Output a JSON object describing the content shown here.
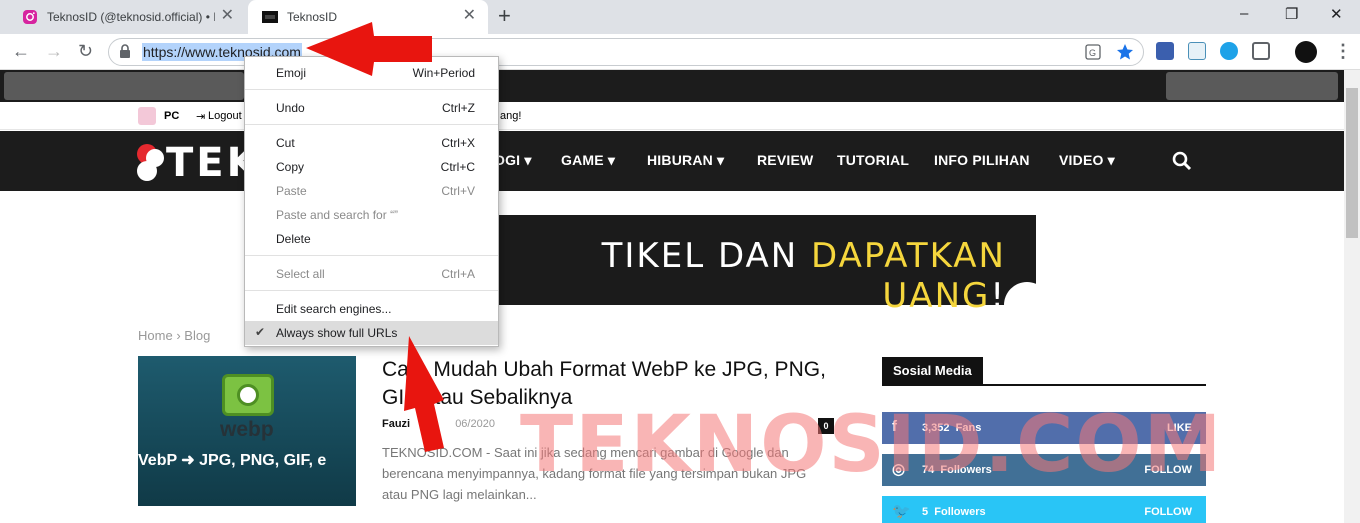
{
  "browser": {
    "tabs": [
      {
        "title": "TeknosID (@teknosid.official) • In",
        "active": false
      },
      {
        "title": "TeknosID",
        "active": true
      }
    ],
    "url": "https://www.teknosid.com",
    "window_controls": {
      "minimize": "–",
      "maximize": "❐",
      "close": "✕"
    }
  },
  "site": {
    "userbar": {
      "username": "PC",
      "logout": "Logout",
      "tail_text": "ang!"
    },
    "logo": "TEKA",
    "nav": [
      "OGI",
      "GAME",
      "HIBURAN",
      "REVIEW",
      "TUTORIAL",
      "INFO PILIHAN",
      "VIDEO"
    ],
    "banner": {
      "text_white": "TIKEL DAN",
      "text_highlight": "DAPATKAN UANG",
      "text_end": "!"
    },
    "breadcrumb": {
      "home": "Home",
      "sep": "›",
      "section": "Blog"
    },
    "post": {
      "headline": "Cara Mudah Ubah Format WebP ke JPG, PNG, GIF atau Sebaliknya",
      "author": "Fauzi",
      "date": "06/2020",
      "comments": "0",
      "excerpt": "TEKNOSID.COM - Saat ini jika sedang mencari gambar di Google dan berencana menyimpannya, kadang format file yang tersimpan bukan JPG atau PNG lagi melainkan...",
      "thumb_label_top": "webp",
      "thumb_label_bottom": "VebP  ➜  JPG, PNG, GIF, e"
    },
    "sidebar": {
      "title": "Sosial Media",
      "items": [
        {
          "count": "3,352",
          "unit": "Fans",
          "action": "LIKE",
          "color": "#516eab",
          "icon": "f"
        },
        {
          "count": "74",
          "unit": "Followers",
          "action": "FOLLOW",
          "color": "#417096",
          "icon": "◎"
        },
        {
          "count": "5",
          "unit": "Followers",
          "action": "FOLLOW",
          "color": "#29c5f6",
          "icon": "🐦"
        }
      ]
    },
    "watermark": "TEKNOSID.COM"
  },
  "context_menu": {
    "items": [
      {
        "label": "Emoji",
        "shortcut": "Win+Period",
        "disabled": false
      },
      {
        "label": "Undo",
        "shortcut": "Ctrl+Z",
        "disabled": false
      },
      {
        "label": "Cut",
        "shortcut": "Ctrl+X",
        "disabled": false
      },
      {
        "label": "Copy",
        "shortcut": "Ctrl+C",
        "disabled": false
      },
      {
        "label": "Paste",
        "shortcut": "Ctrl+V",
        "disabled": true
      },
      {
        "label": "Paste and search for “”",
        "shortcut": "",
        "disabled": true
      },
      {
        "label": "Delete",
        "shortcut": "",
        "disabled": false
      },
      {
        "label": "Select all",
        "shortcut": "Ctrl+A",
        "disabled": true
      },
      {
        "label": "Edit search engines...",
        "shortcut": "",
        "disabled": false
      },
      {
        "label": "Always show full URLs",
        "shortcut": "",
        "disabled": false,
        "checked": true
      }
    ]
  },
  "colors": {
    "annotation_arrow": "#e8150f",
    "nav_bg": "#1c1c1c",
    "highlight": "#f5d63d"
  }
}
